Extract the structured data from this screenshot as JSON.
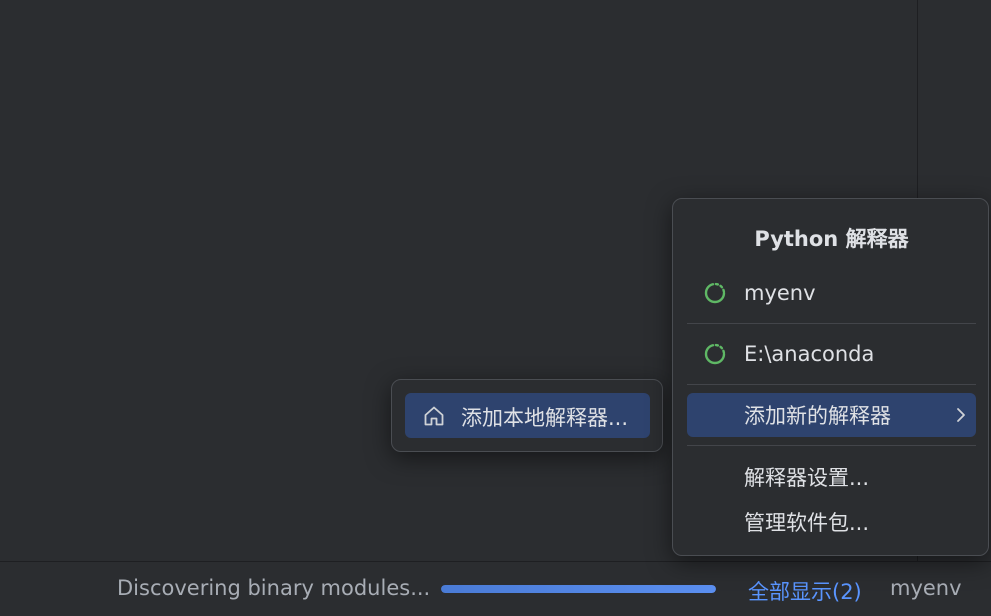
{
  "status_bar": {
    "message": "Discovering binary modules...",
    "progress": 1.0,
    "show_all_label": "全部显示(2)",
    "interpreter_label": "myenv"
  },
  "popup": {
    "title": "Python 解释器",
    "interpreters": [
      {
        "label": "myenv",
        "icon": "loading-spinner-icon"
      },
      {
        "label": "E:\\anaconda",
        "icon": "loading-spinner-icon"
      }
    ],
    "add_new_label": "添加新的解释器",
    "settings_label": "解释器设置...",
    "manage_packages_label": "管理软件包..."
  },
  "submenu": {
    "add_local_label": "添加本地解释器...",
    "icon": "home-icon"
  },
  "colors": {
    "background": "#2b2d30",
    "selection": "#2e436e",
    "accent_link": "#5a95ff",
    "spinner_green": "#5fb865"
  }
}
